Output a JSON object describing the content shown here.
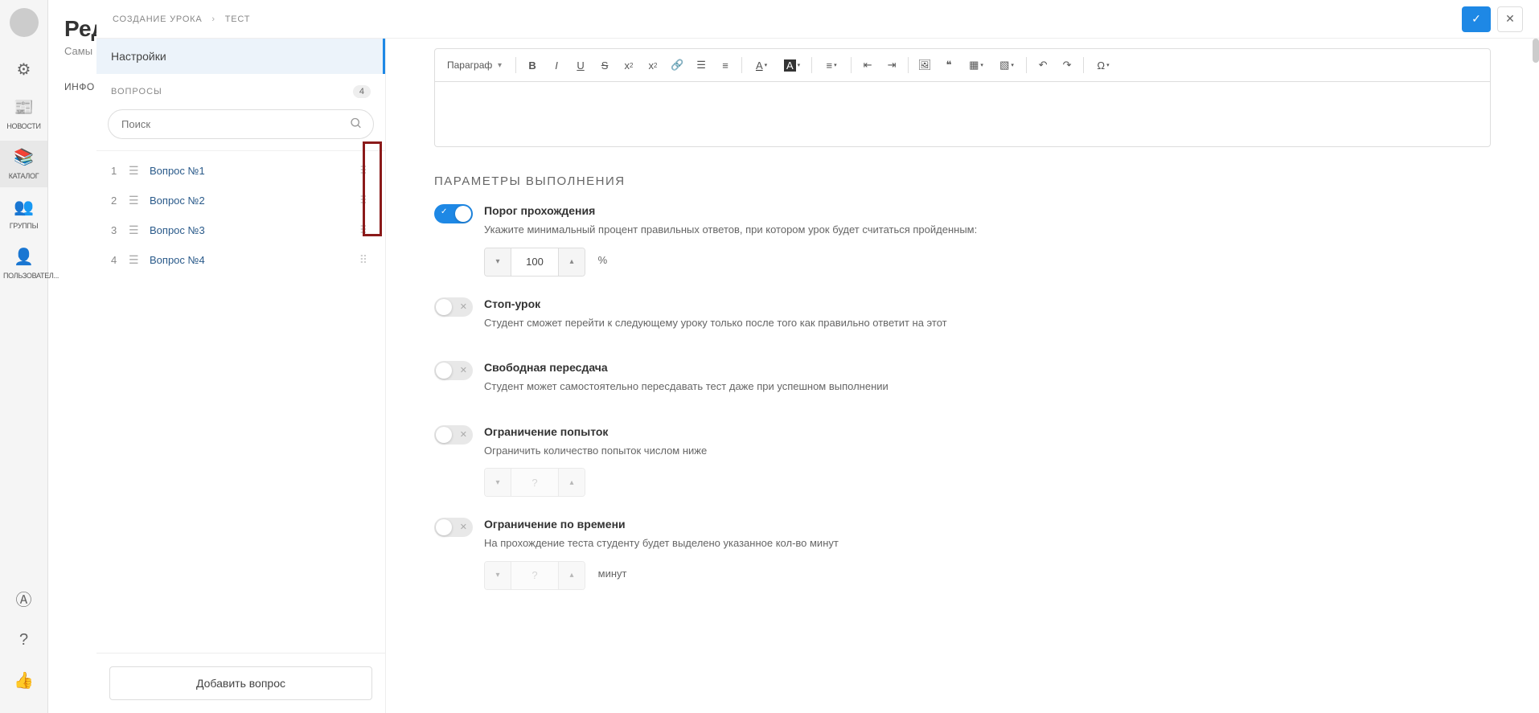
{
  "nav": {
    "items": [
      {
        "label": "НОВОСТИ",
        "icon": "📰"
      },
      {
        "label": "КАТАЛОГ",
        "icon": "📚"
      },
      {
        "label": "ГРУППЫ",
        "icon": "👥"
      },
      {
        "label": "ПОЛЬЗОВАТЕЛ...",
        "icon": "👤"
      }
    ],
    "bottom": [
      {
        "icon": "Ⓐ"
      },
      {
        "icon": "?"
      },
      {
        "icon": "👍"
      }
    ]
  },
  "bg": {
    "title": "Ред",
    "subtitle": "Самы",
    "tab": "ИНФО"
  },
  "breadcrumb": {
    "part1": "СОЗДАНИЕ УРОКА",
    "part2": "ТЕСТ",
    "sep": "›"
  },
  "leftPanel": {
    "settingsTab": "Настройки",
    "questionsLabel": "ВОПРОСЫ",
    "questionsCount": "4",
    "searchPlaceholder": "Поиск",
    "questions": [
      {
        "num": "1",
        "label": "Вопрос №1"
      },
      {
        "num": "2",
        "label": "Вопрос №2"
      },
      {
        "num": "3",
        "label": "Вопрос №3"
      },
      {
        "num": "4",
        "label": "Вопрос №4"
      }
    ],
    "addButton": "Добавить вопрос"
  },
  "editor": {
    "paragraph": "Параграф"
  },
  "section": {
    "title": "ПАРАМЕТРЫ ВЫПОЛНЕНИЯ"
  },
  "params": {
    "threshold": {
      "title": "Порог прохождения",
      "desc": "Укажите минимальный процент правильных ответов, при котором урок будет считаться пройденным:",
      "value": "100",
      "unit": "%"
    },
    "stop": {
      "title": "Стоп-урок",
      "desc": "Студент сможет перейти к следующему уроку только после того как правильно ответит на этот"
    },
    "retake": {
      "title": "Свободная пересдача",
      "desc": "Студент может самостоятельно пересдавать тест даже при успешном выполнении"
    },
    "attempts": {
      "title": "Ограничение попыток",
      "desc": "Ограничить количество попыток числом ниже",
      "value": "?"
    },
    "time": {
      "title": "Ограничение по времени",
      "desc": "На прохождение теста студенту будет выделено указанное кол-во минут",
      "value": "?",
      "unit": "минут"
    }
  }
}
